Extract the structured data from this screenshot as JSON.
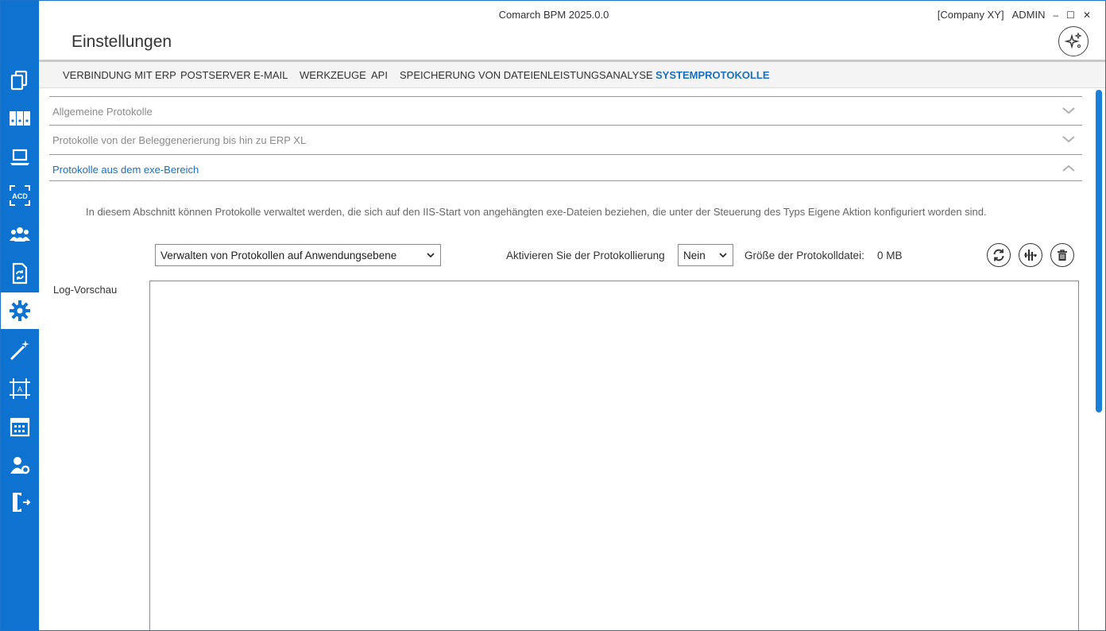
{
  "window": {
    "app_title": "Comarch BPM 2025.0.0",
    "company": "[Company XY]",
    "user": "ADMIN",
    "minimize": "–",
    "maximize": "☐",
    "close": "✕"
  },
  "page": {
    "title": "Einstellungen"
  },
  "sidebar": {
    "items": [
      {
        "icon": "documents-icon"
      },
      {
        "icon": "binders-icon"
      },
      {
        "icon": "laptop-icon"
      },
      {
        "icon": "acd-icon"
      },
      {
        "icon": "users-icon"
      },
      {
        "icon": "document-sync-icon"
      },
      {
        "icon": "gear-icon",
        "active": true
      },
      {
        "icon": "magic-wand-icon"
      },
      {
        "icon": "design-frame-icon"
      },
      {
        "icon": "calendar-icon"
      },
      {
        "icon": "user-settings-icon"
      },
      {
        "icon": "exit-door-icon"
      }
    ]
  },
  "tabs": [
    {
      "label": "VERBINDUNG MIT ERP"
    },
    {
      "label": "POSTSERVER"
    },
    {
      "label": "E-MAIL"
    },
    {
      "label": "WERKZEUGE"
    },
    {
      "label": "API"
    },
    {
      "label": "SPEICHERUNG VON DATEIEN"
    },
    {
      "label": "LEISTUNGSANALYSE"
    },
    {
      "label": "SYSTEMPROTOKOLLE",
      "active": true
    }
  ],
  "accordion": [
    {
      "label": "Allgemeine Protokolle",
      "expanded": false
    },
    {
      "label": "Protokolle von der Beleggenerierung bis hin zu ERP XL",
      "expanded": false
    },
    {
      "label": "Protokolle aus dem exe-Bereich",
      "expanded": true
    }
  ],
  "section": {
    "description": "In diesem Abschnitt können Protokolle verwaltet werden, die sich auf den IIS-Start von angehängten exe-Dateien beziehen, die unter der Steuerung des Typs Eigene Aktion konfiguriert worden sind.",
    "level_select": "Verwalten von Protokollen auf Anwendungsebene",
    "enable_label": "Aktivieren Sie der Protokollierung",
    "enable_value": "Nein",
    "size_label": "Größe der Protokolldatei:",
    "size_value": "0 MB",
    "preview_label": "Log-Vorschau",
    "preview_content": ""
  },
  "colors": {
    "accent": "#0d72d0",
    "active_text": "#1a6fbf"
  }
}
